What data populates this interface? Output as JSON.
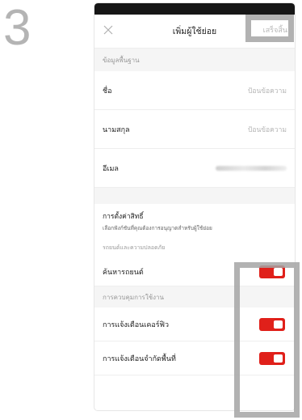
{
  "step_number": "3",
  "header": {
    "title": "เพิ่มผู้ใช้ย่อย",
    "done_label": "เสร็จสิ้น",
    "close_icon": "close-icon"
  },
  "basic_info": {
    "section_label": "ข้อมูลพื้นฐาน",
    "first_name": {
      "label": "ชื่อ",
      "placeholder": "ป้อนข้อความ"
    },
    "last_name": {
      "label": "นามสกุล",
      "placeholder": "ป้อนข้อความ"
    },
    "email": {
      "label": "อีเมล"
    }
  },
  "permissions": {
    "title": "การตั้งค่าสิทธิ์",
    "description": "เลือกฟังก์ชันที่คุณต้องการอนุญาตสำหรับผู้ใช้ย่อย",
    "vehicle_section": "รถยนต์และความปลอดภัย",
    "find_car": {
      "label": "ค้นหารถยนต์",
      "enabled": true
    },
    "usage_section": "การควบคุมการใช้งาน",
    "curfew_alert": {
      "label": "การแจ้งเตือนเคอร์ฟิว",
      "enabled": true
    },
    "geofence_alert": {
      "label": "การแจ้งเตือนจำกัดพื้นที่",
      "enabled": true
    }
  },
  "colors": {
    "accent": "#e0201a",
    "highlight": "#a5a5a5",
    "section_bg": "#f5f5f5"
  }
}
